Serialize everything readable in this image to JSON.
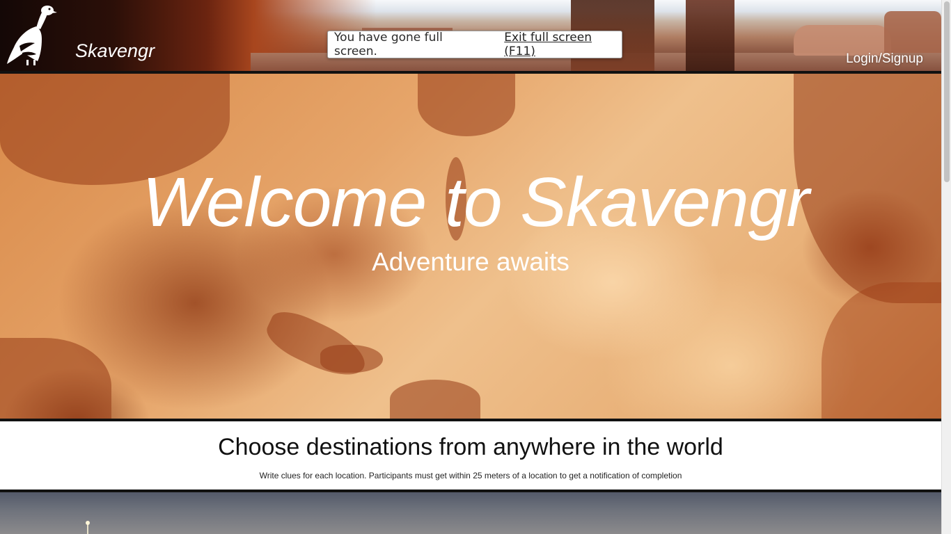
{
  "header": {
    "brand": "Skavengr",
    "login_label": "Login/Signup",
    "logo_icon": "vulture-icon"
  },
  "fullscreen_notice": {
    "message": "You have gone full screen.",
    "exit_label": "Exit full screen (F11)"
  },
  "hero": {
    "title": "Welcome to Skavengr",
    "subtitle": "Adventure awaits"
  },
  "section": {
    "heading": "Choose destinations from anywhere in the world",
    "description": "Write clues for each location. Participants must get within 25 meters of a location to get a notification of completion"
  },
  "colors": {
    "accent": "#a8461e",
    "border": "#111111"
  }
}
